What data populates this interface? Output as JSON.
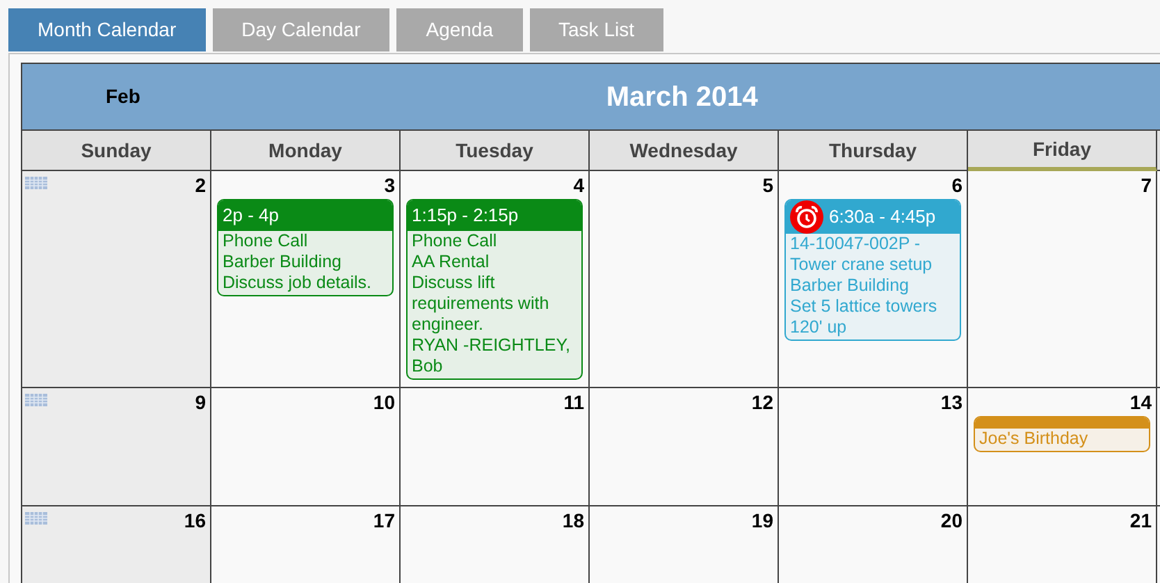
{
  "tabs": [
    {
      "label": "Month Calendar",
      "selected": true
    },
    {
      "label": "Day Calendar",
      "selected": false
    },
    {
      "label": "Agenda",
      "selected": false
    },
    {
      "label": "Task List",
      "selected": false
    }
  ],
  "calendar": {
    "prev_month": "Feb",
    "title": "March 2014",
    "weekdays": [
      {
        "label": "Sunday",
        "today": false
      },
      {
        "label": "Monday",
        "today": false
      },
      {
        "label": "Tuesday",
        "today": false
      },
      {
        "label": "Wednesday",
        "today": false
      },
      {
        "label": "Thursday",
        "today": false
      },
      {
        "label": "Friday",
        "today": true
      }
    ],
    "weeks": [
      {
        "days": [
          {
            "number": "2"
          },
          {
            "number": "3",
            "events": [
              {
                "time": "2p - 4p",
                "alarm": false,
                "color": "#0a8a16",
                "lines": [
                  "Phone Call",
                  "Barber Building",
                  "Discuss job details."
                ]
              }
            ]
          },
          {
            "number": "4",
            "events": [
              {
                "time": "1:15p - 2:15p",
                "alarm": false,
                "color": "#0a8a16",
                "lines": [
                  "Phone Call",
                  "AA Rental",
                  "Discuss lift requirements with engineer.",
                  "RYAN -REIGHTLEY, Bob"
                ]
              }
            ]
          },
          {
            "number": "5"
          },
          {
            "number": "6",
            "events": [
              {
                "time": "6:30a - 4:45p",
                "alarm": true,
                "color": "#31a8cf",
                "lines": [
                  "14-10047-002P - Tower crane setup",
                  "Barber Building",
                  "Set 5 lattice towers 120' up"
                ]
              }
            ]
          },
          {
            "number": "7"
          }
        ]
      },
      {
        "days": [
          {
            "number": "9"
          },
          {
            "number": "10"
          },
          {
            "number": "11"
          },
          {
            "number": "12"
          },
          {
            "number": "13"
          },
          {
            "number": "14",
            "events": [
              {
                "alarm": false,
                "color": "#d4901a",
                "lines": [
                  "Joe's Birthday"
                ]
              }
            ]
          }
        ]
      },
      {
        "days": [
          {
            "number": "16"
          },
          {
            "number": "17"
          },
          {
            "number": "18"
          },
          {
            "number": "19"
          },
          {
            "number": "20"
          },
          {
            "number": "21"
          }
        ]
      }
    ]
  }
}
